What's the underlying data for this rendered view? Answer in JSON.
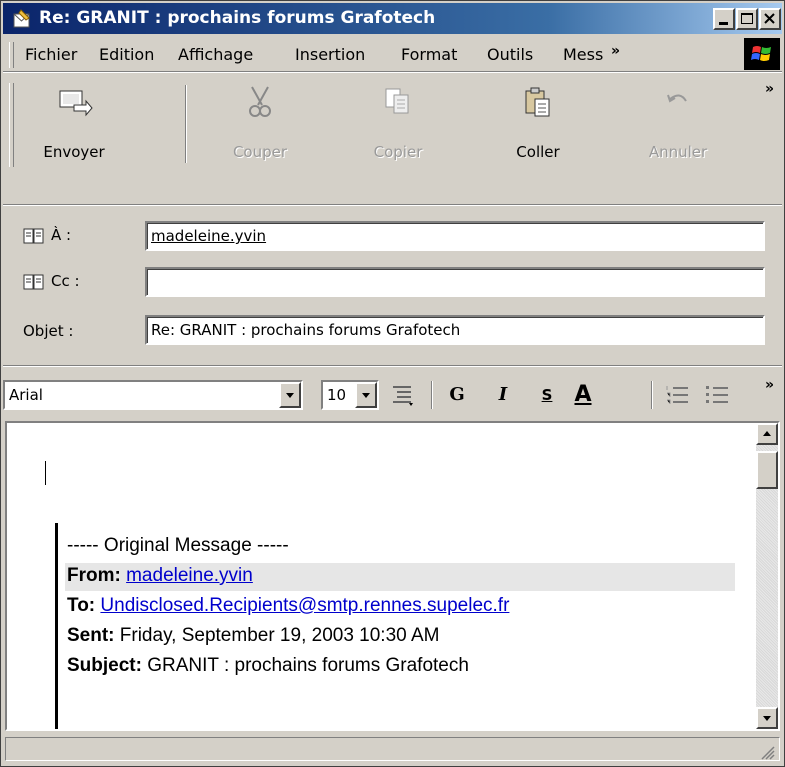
{
  "window": {
    "title": "Re: GRANIT : prochains forums Grafotech"
  },
  "menubar": {
    "items": [
      "Fichier",
      "Edition",
      "Affichage",
      "Insertion",
      "Format",
      "Outils",
      "Mess"
    ],
    "more": "»"
  },
  "toolbar": {
    "buttons": [
      {
        "label": "Envoyer",
        "icon": "send-icon",
        "enabled": true
      },
      {
        "label": "Couper",
        "icon": "scissors-icon",
        "enabled": false
      },
      {
        "label": "Copier",
        "icon": "copy-icon",
        "enabled": false
      },
      {
        "label": "Coller",
        "icon": "paste-icon",
        "enabled": true
      },
      {
        "label": "Annuler",
        "icon": "undo-icon",
        "enabled": false
      }
    ],
    "more": "»"
  },
  "header": {
    "to_label": "À :",
    "to_value": "madeleine.yvin",
    "cc_label": "Cc :",
    "cc_value": "",
    "subject_label": "Objet :",
    "subject_value": "Re: GRANIT : prochains forums Grafotech"
  },
  "format": {
    "font": "Arial",
    "size": "10",
    "bold": "G",
    "italic": "I",
    "underline": "S",
    "color": "A",
    "more": "»"
  },
  "message": {
    "original_header": "----- Original Message -----",
    "from_label": "From:",
    "from_value": "madeleine.yvin",
    "to_label": "To:",
    "to_value": "Undisclosed.Recipients@smtp.rennes.supelec.fr",
    "sent_label": "Sent:",
    "sent_value": "Friday, September 19, 2003 10:30 AM",
    "subject_label": "Subject:",
    "subject_value": "GRANIT : prochains forums Grafotech"
  },
  "colors": {
    "titlebar_start": "#0a246a",
    "titlebar_end": "#a6caf0",
    "link": "#0000cc",
    "chrome": "#d4d0c8"
  }
}
